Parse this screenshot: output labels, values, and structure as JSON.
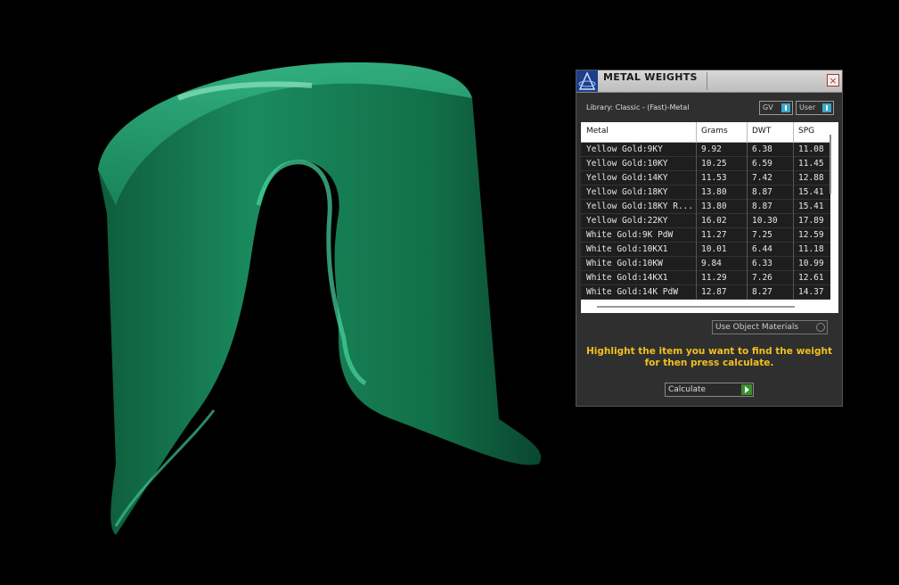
{
  "window": {
    "title": "METAL WEIGHTS",
    "close_label": "×"
  },
  "library": {
    "label": "Library: Classic - (Fast)-Metal"
  },
  "toggles": {
    "gv_label": "GV",
    "user_label": "User"
  },
  "table": {
    "headers": [
      "Metal",
      "Grams",
      "DWT",
      "SPG"
    ],
    "rows": [
      {
        "metal": "Yellow Gold:9KY",
        "grams": "9.92",
        "dwt": "6.38",
        "spg": "11.08"
      },
      {
        "metal": "Yellow Gold:10KY",
        "grams": "10.25",
        "dwt": "6.59",
        "spg": "11.45"
      },
      {
        "metal": "Yellow Gold:14KY",
        "grams": "11.53",
        "dwt": "7.42",
        "spg": "12.88"
      },
      {
        "metal": "Yellow Gold:18KY",
        "grams": "13.80",
        "dwt": "8.87",
        "spg": "15.41"
      },
      {
        "metal": "Yellow Gold:18KY R...",
        "grams": "13.80",
        "dwt": "8.87",
        "spg": "15.41"
      },
      {
        "metal": "Yellow Gold:22KY",
        "grams": "16.02",
        "dwt": "10.30",
        "spg": "17.89"
      },
      {
        "metal": "White Gold:9K PdW",
        "grams": "11.27",
        "dwt": "7.25",
        "spg": "12.59"
      },
      {
        "metal": "White Gold:10KX1",
        "grams": "10.01",
        "dwt": "6.44",
        "spg": "11.18"
      },
      {
        "metal": "White Gold:10KW",
        "grams": "9.84",
        "dwt": "6.33",
        "spg": "10.99"
      },
      {
        "metal": "White Gold:14KX1",
        "grams": "11.29",
        "dwt": "7.26",
        "spg": "12.61"
      },
      {
        "metal": "White Gold:14K PdW",
        "grams": "12.87",
        "dwt": "8.27",
        "spg": "14.37"
      }
    ]
  },
  "options": {
    "use_object_materials": "Use Object Materials"
  },
  "instruction": "Highlight the item you want to find the weight for then press calculate.",
  "actions": {
    "calculate_label": "Calculate"
  },
  "colors": {
    "model_green": "#1a8a5e",
    "panel_bg": "#2f2f2f",
    "instruction_text": "#f0c020",
    "toggle_accent": "#3aa7c9",
    "calculate_arrow": "#3b8f2a"
  }
}
